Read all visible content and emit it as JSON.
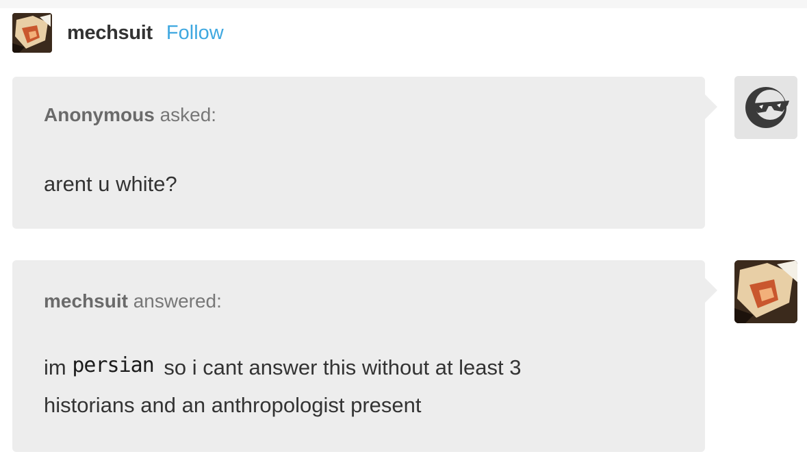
{
  "post": {
    "username": "mechsuit",
    "follow_label": "Follow",
    "avatar_icon": "user-avatar-icon"
  },
  "ask": {
    "asker": "Anonymous",
    "action": "asked:",
    "text": "arent u white?",
    "avatar_icon": "anonymous-sunglasses-icon"
  },
  "answer": {
    "answerer": "mechsuit",
    "action": "answered:",
    "text_before": "im",
    "handwritten_word": "persian",
    "text_after": "so i cant answer this without at least 3",
    "text_line2": "historians and an anthropologist present",
    "avatar_icon": "user-avatar-icon"
  },
  "colors": {
    "bubble": "#ededed",
    "follow": "#3fa8e0",
    "text": "#333333",
    "meta": "#777777"
  }
}
